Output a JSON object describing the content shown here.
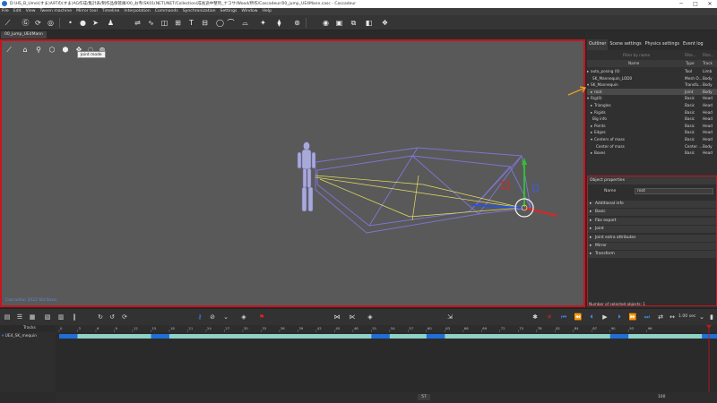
{
  "window": {
    "title": "D:\\HS_B_Ume\\(すま)A9Tの(すま)AG作成/集計表/制作品保管庫/00_お寺/SK01(NET)/NET/Collection/成長途中整列_ナコサ/Wood/所作/Cascadeur/00_jump_UE4Mann.casc - Cascadeur",
    "min_glyph": "─",
    "max_glyph": "□",
    "close_glyph": "✕"
  },
  "menu": [
    "File",
    "Edit",
    "View",
    "Tween machine",
    "Mirror tool",
    "Timeline",
    "Interpolation",
    "Commands",
    "Synchronization",
    "Settings",
    "Window",
    "Help"
  ],
  "document_tab": "00_jump_UE4Mann",
  "viewport": {
    "tooltip": "Joint mode",
    "watermark": "Cascadeur 2022 Std Basic"
  },
  "right_panel": {
    "tabs": [
      "Outliner",
      "Scene settings",
      "Physics settings",
      "Event log"
    ],
    "filter_name_placeholder": "Filter by name",
    "filter_type_placeholder": "Filte...",
    "filter_track_placeholder": "Filte...",
    "columns": {
      "name": "Name",
      "type": "Type",
      "track": "Track"
    },
    "rows": [
      {
        "name": "auto_posing (0)",
        "type": "Tool",
        "track": "Limb",
        "indent": 0,
        "arrow": "▸",
        "selected": false
      },
      {
        "name": "SK_Mannequin_LOD0",
        "type": "Mesh O...",
        "track": "Body",
        "indent": 1,
        "arrow": "",
        "selected": false
      },
      {
        "name": "SK_Mannequin",
        "type": "Transfo...",
        "track": "Body",
        "indent": 0,
        "arrow": "▾",
        "selected": false
      },
      {
        "name": "root",
        "type": "Joint",
        "track": "Body",
        "indent": 1,
        "arrow": "▸",
        "selected": true
      },
      {
        "name": "Rig(0)",
        "type": "Basic",
        "track": "Head",
        "indent": 0,
        "arrow": "▾",
        "selected": false
      },
      {
        "name": "Triangles",
        "type": "Basic",
        "track": "Head",
        "indent": 1,
        "arrow": "▸",
        "selected": false
      },
      {
        "name": "Rigids",
        "type": "Basic",
        "track": "Head",
        "indent": 1,
        "arrow": "▸",
        "selected": false
      },
      {
        "name": "Big info",
        "type": "Basic",
        "track": "Head",
        "indent": 1,
        "arrow": "",
        "selected": false
      },
      {
        "name": "Points",
        "type": "Basic",
        "track": "Head",
        "indent": 1,
        "arrow": "▸",
        "selected": false
      },
      {
        "name": "Edges",
        "type": "Basic",
        "track": "Head",
        "indent": 1,
        "arrow": "▸",
        "selected": false
      },
      {
        "name": "Centers of mass",
        "type": "Basic",
        "track": "Head",
        "indent": 1,
        "arrow": "▾",
        "selected": false
      },
      {
        "name": "Center of mass",
        "type": "Center ...",
        "track": "Body",
        "indent": 2,
        "arrow": "",
        "selected": false
      },
      {
        "name": "Boxes",
        "type": "Basic",
        "track": "Head",
        "indent": 1,
        "arrow": "▸",
        "selected": false
      }
    ],
    "object_properties": {
      "title": "Object properties",
      "name_label": "Name",
      "name_value": "root",
      "sections": [
        "Additional info",
        "Basic",
        "Fbx export",
        "Joint",
        "Joint extra attributes",
        "Mirror",
        "Transform"
      ]
    },
    "status": "Number of selected objects: 1"
  },
  "playback": {
    "fps": "1.00 sec"
  },
  "timeline": {
    "tracks_header": "Tracks",
    "track_name": "UE4_SK_mequin",
    "ticks": [
      "0",
      "3",
      "6",
      "9",
      "12",
      "15",
      "18",
      "21",
      "24",
      "27",
      "30",
      "33",
      "36",
      "39",
      "42",
      "45",
      "48",
      "51",
      "54",
      "57",
      "60",
      "63",
      "66",
      "69",
      "72",
      "75",
      "78",
      "81",
      "84",
      "87",
      "90",
      "93",
      "96"
    ],
    "keyframes": [
      0,
      15,
      51,
      60,
      90,
      105
    ],
    "frame_count": 106,
    "current_frame": "57",
    "end_frame": "100"
  },
  "colors": {
    "accent_red": "#c8141e",
    "track_fill": "#8fd1c6",
    "key_blue": "#1f6fd6",
    "cage_blue": "#7f76d6",
    "bone_yellow": "#e6e060"
  }
}
